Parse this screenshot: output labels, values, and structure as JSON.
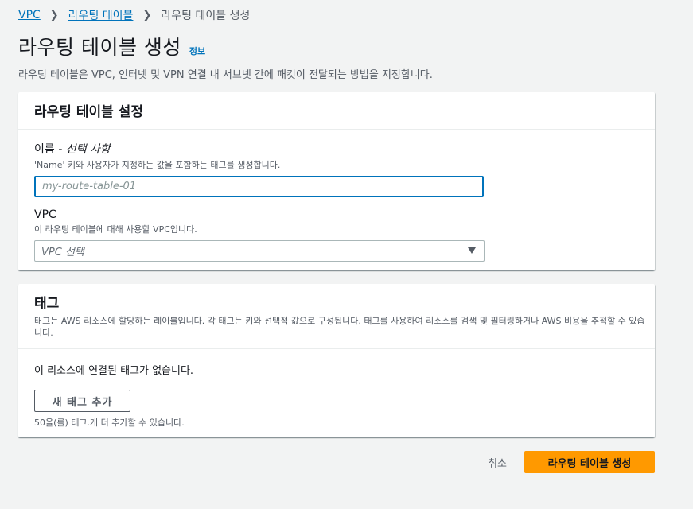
{
  "breadcrumb": {
    "root": "VPC",
    "parent": "라우팅 테이블",
    "current": "라우팅 테이블 생성"
  },
  "header": {
    "title": "라우팅 테이블 생성",
    "info": "정보",
    "description": "라우팅 테이블은 VPC, 인터넷 및 VPN 연결 내 서브넷 간에 패킷이 전달되는 방법을 지정합니다."
  },
  "settings": {
    "title": "라우팅 테이블 설정",
    "name_label": "이름",
    "name_optional": "- 선택 사항",
    "name_desc": "'Name' 키와 사용자가 지정하는 값을 포함하는 태그를 생성합니다.",
    "name_placeholder": "my-route-table-01",
    "vpc_label": "VPC",
    "vpc_desc": "이 라우팅 테이블에 대해 사용할 VPC입니다.",
    "vpc_placeholder": "VPC 선택"
  },
  "tags": {
    "title": "태그",
    "description": "태그는 AWS 리소스에 할당하는 레이블입니다. 각 태그는 키와 선택적 값으로 구성됩니다. 태그를 사용하여 리소스를 검색 및 필터링하거나 AWS 비용을 추적할 수 있습니다.",
    "empty": "이 리소스에 연결된 태그가 없습니다.",
    "add_button": "새 태그 추가",
    "limit": "50을(를) 태그.개 더 추가할 수 있습니다."
  },
  "footer": {
    "cancel": "취소",
    "submit": "라우팅 테이블 생성"
  },
  "colors": {
    "link": "#0073bb",
    "primary": "#ff9900",
    "background": "#f2f3f3"
  }
}
